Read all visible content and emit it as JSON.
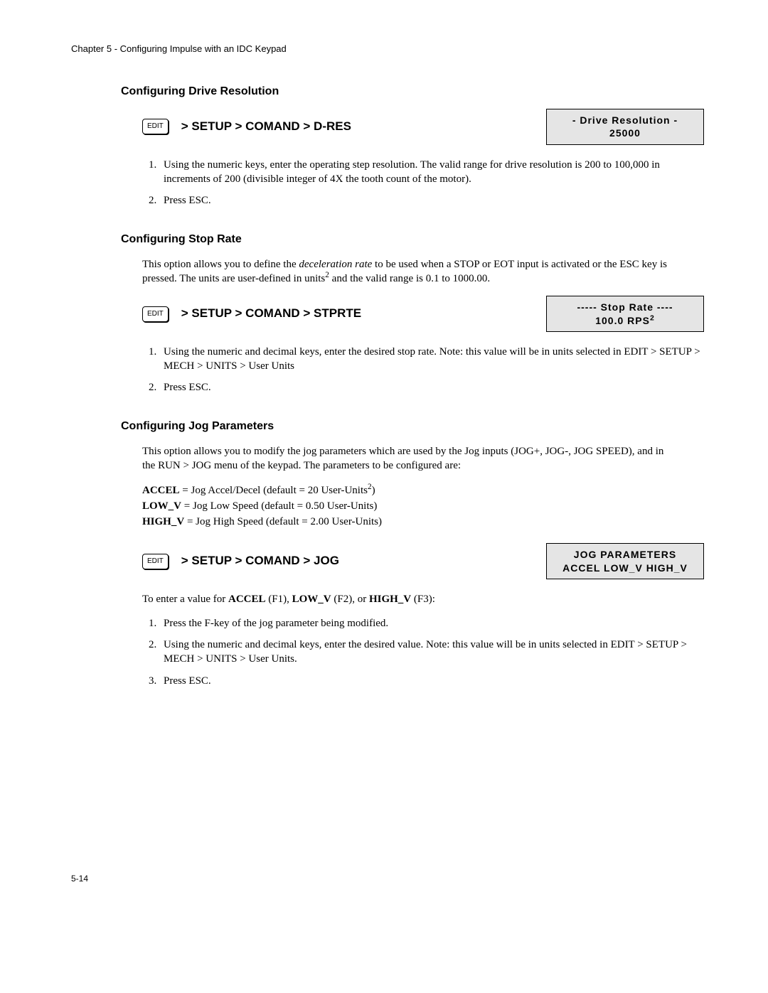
{
  "chapter_header": "Chapter 5 - Configuring Impulse with an IDC Keypad",
  "page_number": "5-14",
  "edit_key_label": "EDIT",
  "drive_res": {
    "title": "Configuring Drive Resolution",
    "nav": "> SETUP > COMAND > D-RES",
    "lcd_line1": "-  Drive  Resolution  -",
    "lcd_line2": "25000",
    "step1": "Using the numeric keys, enter the operating step resolution. The valid range for drive resolution is 200 to 100,000 in increments of 200 (divisible integer of 4X the tooth count of the motor).",
    "step2": "Press ESC."
  },
  "stop_rate": {
    "title": "Configuring Stop Rate",
    "intro_a": "This option allows you to define the ",
    "intro_em": "deceleration rate",
    "intro_b": " to be used when a STOP or EOT input is activated or the ESC key is pressed. The units are user-defined in units",
    "intro_c": " and the valid range is 0.1 to 1000.00.",
    "nav": "> SETUP > COMAND > STPRTE",
    "lcd_line1": "-----  Stop  Rate  ----",
    "lcd_value": "100.0 RPS",
    "step1": "Using the numeric and decimal keys, enter the desired stop rate. Note: this value will be in units selected in EDIT > SETUP > MECH > UNITS > User Units",
    "step2": "Press ESC."
  },
  "jog": {
    "title": "Configuring Jog Parameters",
    "intro": "This option allows you to modify the jog parameters which are used by the Jog inputs (JOG+, JOG-, JOG SPEED), and in the RUN > JOG menu of the keypad. The parameters to be configured are:",
    "accel_label": "ACCEL",
    "accel_desc_a": " = Jog Accel/Decel (default = 20 User-Units",
    "accel_desc_b": ")",
    "lowv_label": "LOW_V",
    "lowv_desc": " = Jog Low Speed (default = 0.50 User-Units)",
    "highv_label": "HIGH_V",
    "highv_desc": " = Jog High Speed (default = 2.00 User-Units)",
    "nav": "> SETUP > COMAND > JOG",
    "lcd_line1": "JOG   PARAMETERS",
    "lcd_line2": "ACCEL   LOW_V   HIGH_V",
    "enter_text_a": "To enter a value for ",
    "enter_accel": "ACCEL",
    "enter_f1": " (F1), ",
    "enter_lowv": "LOW_V",
    "enter_f2": " (F2), or ",
    "enter_highv": "HIGH_V",
    "enter_f3": " (F3):",
    "step1": "Press the F-key of the jog parameter being modified.",
    "step2": "Using the numeric and decimal keys, enter the desired value. Note: this value will be in units selected in EDIT > SETUP > MECH > UNITS > User Units.",
    "step3": "Press ESC."
  }
}
